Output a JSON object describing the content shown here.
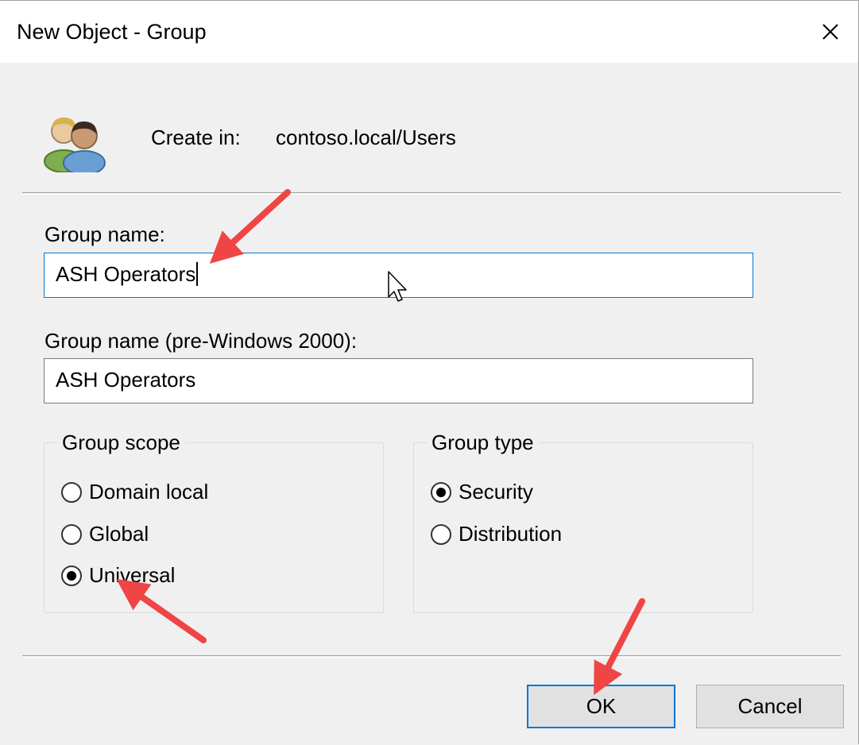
{
  "window": {
    "title": "New Object - Group",
    "close_icon": "close-icon"
  },
  "header": {
    "icon": "users-group-icon",
    "create_in_label": "Create in:",
    "create_in_value": "contoso.local/Users"
  },
  "fields": {
    "group_name_label": "Group name:",
    "group_name_value": "ASH Operators",
    "group_name_pre2000_label": "Group name (pre-Windows 2000):",
    "group_name_pre2000_value": "ASH Operators"
  },
  "group_scope": {
    "title": "Group scope",
    "options": [
      "Domain local",
      "Global",
      "Universal"
    ],
    "selected": "Universal"
  },
  "group_type": {
    "title": "Group type",
    "options": [
      "Security",
      "Distribution"
    ],
    "selected": "Security"
  },
  "buttons": {
    "ok_label": "OK",
    "cancel_label": "Cancel"
  },
  "colors": {
    "focus_border": "#0078d7",
    "annotation_arrow": "#f04545"
  }
}
